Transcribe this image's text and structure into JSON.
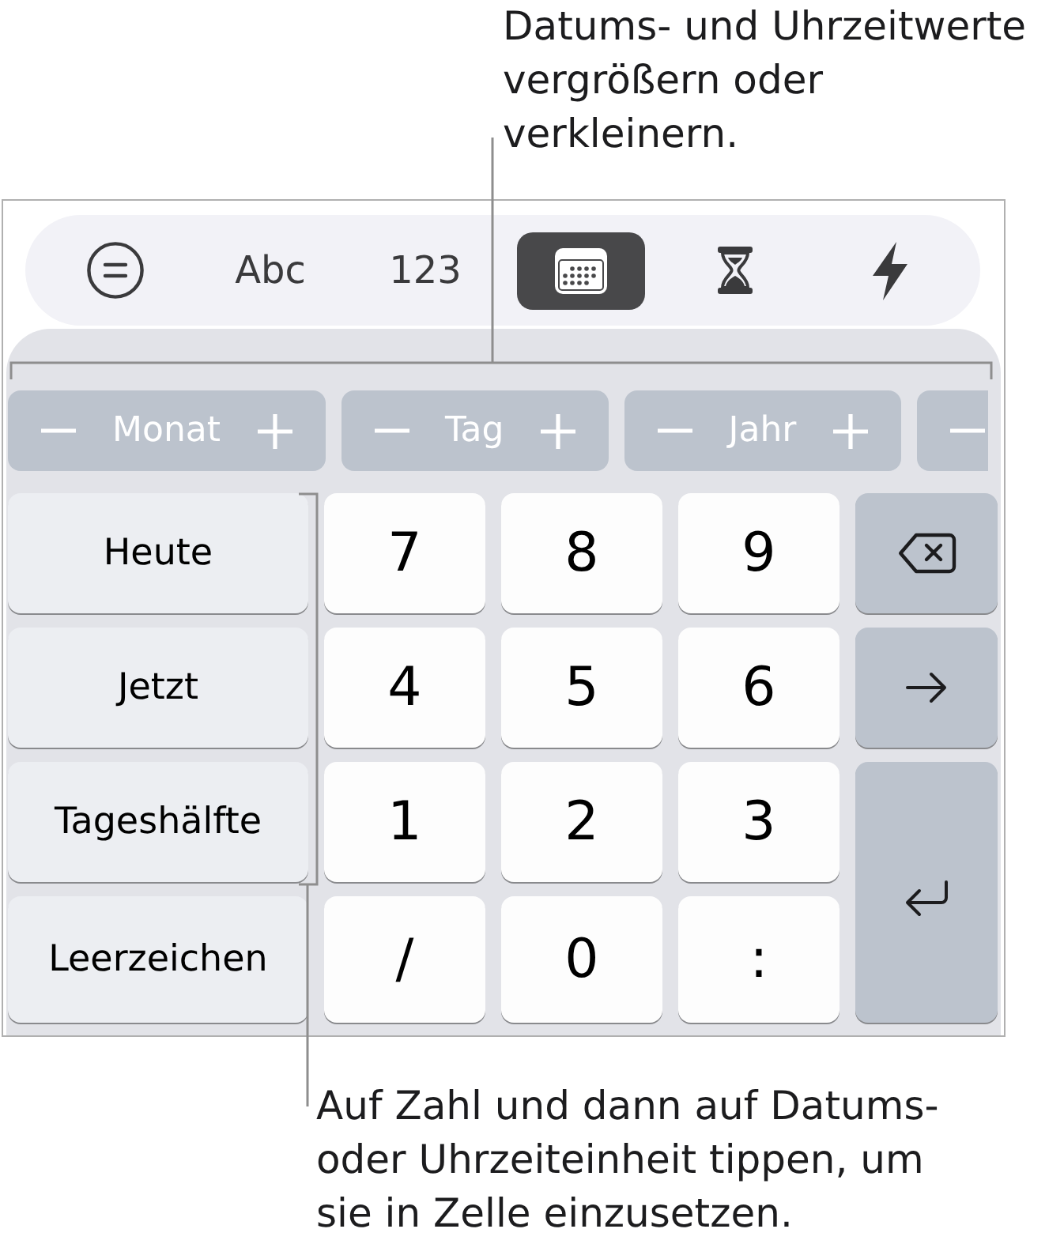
{
  "top_callout": {
    "text": "Datums- und Uhrzeitwerte vergrößern oder verkleinern."
  },
  "mode_tabs": [
    {
      "kind": "formula",
      "selected": false
    },
    {
      "kind": "text",
      "label": "Abc",
      "selected": false
    },
    {
      "kind": "text",
      "label": "123",
      "selected": false
    },
    {
      "kind": "date",
      "selected": true
    },
    {
      "kind": "duration",
      "selected": false
    },
    {
      "kind": "action",
      "selected": false
    }
  ],
  "steppers": [
    {
      "kind": "full",
      "label": "Monat"
    },
    {
      "kind": "full",
      "label": "Tag"
    },
    {
      "kind": "full",
      "label": "Jahr"
    },
    {
      "kind": "cut"
    }
  ],
  "unit_keys": [
    "Heute",
    "Jetzt",
    "Tageshälfte",
    "Leerzeichen"
  ],
  "number_keys": [
    "7",
    "8",
    "9",
    "4",
    "5",
    "6",
    "1",
    "2",
    "3",
    "/",
    "0",
    ":"
  ],
  "action_keys": [
    {
      "kind": "delete"
    },
    {
      "kind": "next"
    },
    {
      "kind": "return"
    }
  ],
  "bottom_callout": {
    "text": "Auf Zahl und dann auf Datums- oder Uhrzeiteinheit tippen, um sie in Zelle einzusetzen."
  }
}
